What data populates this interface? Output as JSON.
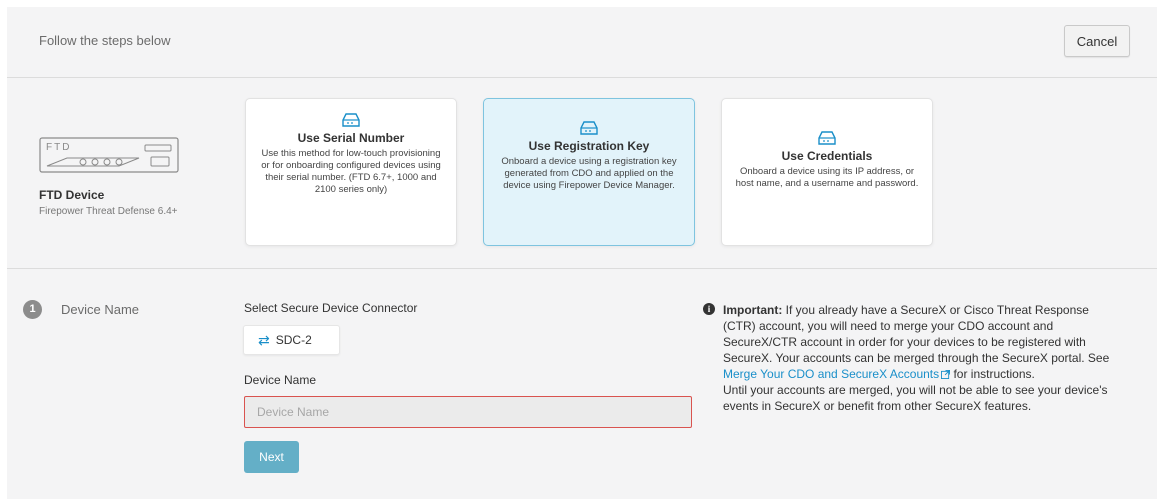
{
  "header": {
    "title": "Follow the steps below",
    "cancel_label": "Cancel"
  },
  "device": {
    "graphic_label": "FTD",
    "title": "FTD Device",
    "subtitle": "Firepower Threat Defense 6.4+"
  },
  "cards": [
    {
      "title": "Use Serial Number",
      "description": "Use this method for low-touch provisioning or for onboarding configured devices using their serial number. (FTD 6.7+, 1000 and 2100 series only)",
      "selected": false
    },
    {
      "title": "Use Registration Key",
      "description": "Onboard a device using a registration key generated from CDO and applied on the device using Firepower Device Manager.",
      "selected": true
    },
    {
      "title": "Use Credentials",
      "description": "Onboard a device using its IP address, or host name, and a username and password.",
      "selected": false
    }
  ],
  "step": {
    "number": "1",
    "label": "Device Name",
    "sdc_label": "Select Secure Device Connector",
    "sdc_value": "SDC-2",
    "name_label": "Device Name",
    "name_placeholder": "Device Name",
    "name_value": "",
    "next_label": "Next"
  },
  "note": {
    "important": "Important:",
    "text_before_link": " If you already have a SecureX or Cisco Threat Response (CTR) account, you will need to merge your CDO account and SecureX/CTR account in order for your devices to be registered with SecureX. Your accounts can be merged through the SecureX portal. See ",
    "link_text": "Merge Your CDO and SecureX Accounts",
    "text_after_link": " for instructions.",
    "text_second": "Until your accounts are merged, you will not be able to see your device's events in SecureX or benefit from other SecureX features."
  },
  "colors": {
    "background": "#f4f4f5",
    "selected_card": "#e2f3fa",
    "selected_border": "#7ec4df",
    "accent": "#1a8fc9",
    "next_button": "#64afc7",
    "error_border": "#d9534f"
  }
}
